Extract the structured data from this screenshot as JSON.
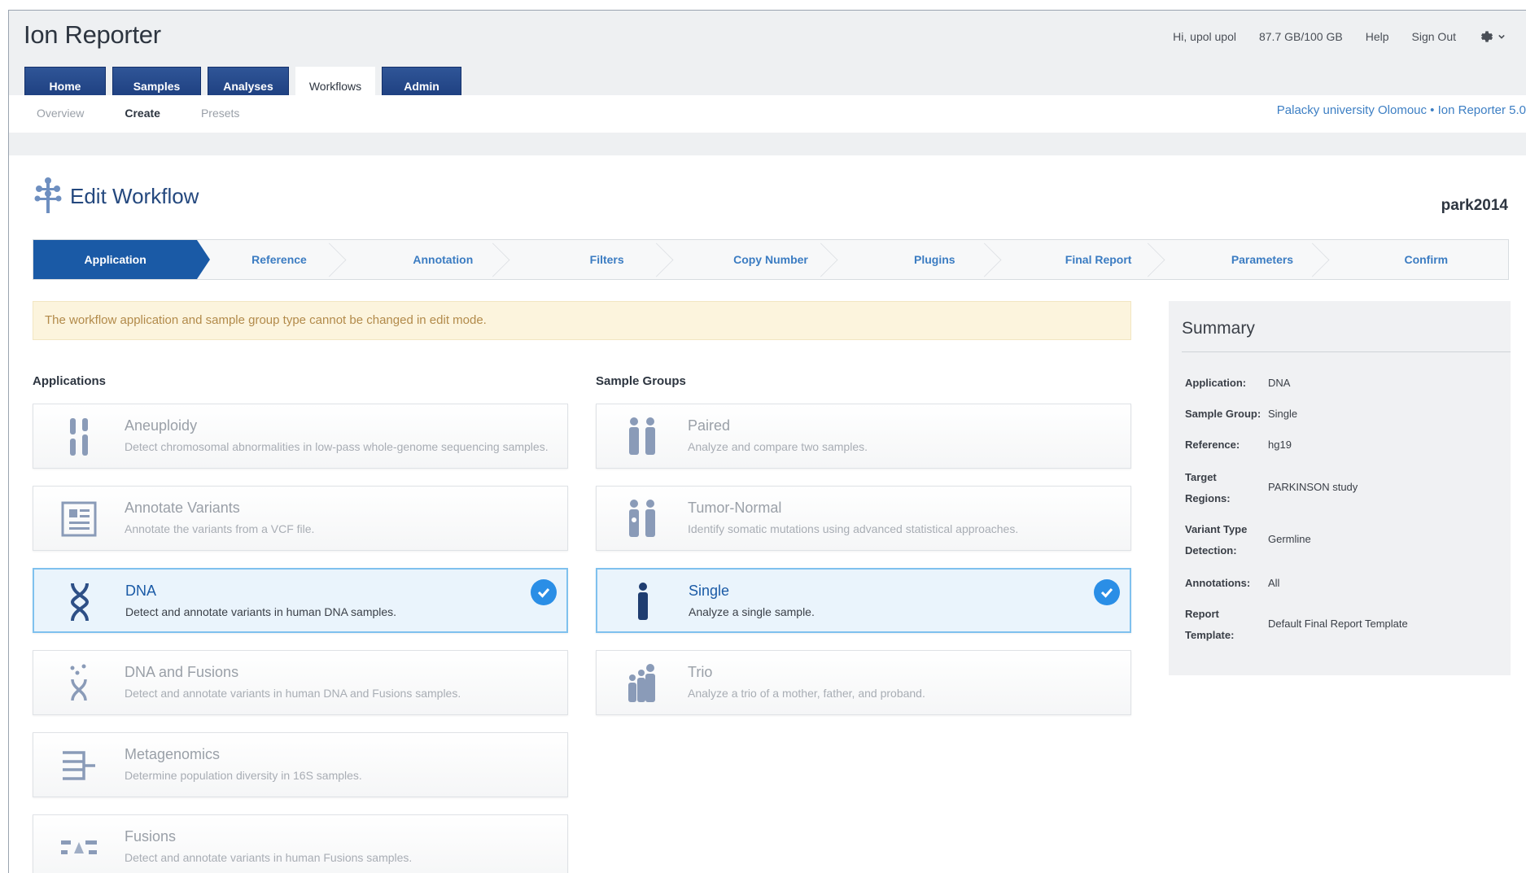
{
  "header": {
    "app_title": "Ion Reporter",
    "user": "Hi, upol upol",
    "storage": "87.7 GB/100 GB",
    "help": "Help",
    "sign_out": "Sign Out"
  },
  "tabs": [
    {
      "label": "Home"
    },
    {
      "label": "Samples"
    },
    {
      "label": "Analyses"
    },
    {
      "label": "Workflows"
    },
    {
      "label": "Admin"
    }
  ],
  "subnav": {
    "items": [
      "Overview",
      "Create",
      "Presets"
    ],
    "breadcrumb": "Palacky university Olomouc  •  Ion Reporter 5.0"
  },
  "page": {
    "title": "Edit Workflow",
    "workflow_name": "park2014",
    "notice": "The workflow application and sample group type cannot be changed in edit mode."
  },
  "steps": [
    "Application",
    "Reference",
    "Annotation",
    "Filters",
    "Copy Number",
    "Plugins",
    "Final Report",
    "Parameters",
    "Confirm"
  ],
  "applications": {
    "title": "Applications",
    "items": [
      {
        "title": "Aneuploidy",
        "desc": "Detect chromosomal abnormalities in low-pass whole-genome sequencing samples."
      },
      {
        "title": "Annotate Variants",
        "desc": "Annotate the variants from a VCF file."
      },
      {
        "title": "DNA",
        "desc": "Detect and annotate variants in human DNA samples."
      },
      {
        "title": "DNA and Fusions",
        "desc": "Detect and annotate variants in human DNA and Fusions samples."
      },
      {
        "title": "Metagenomics",
        "desc": "Determine population diversity in 16S samples."
      },
      {
        "title": "Fusions",
        "desc": "Detect and annotate variants in human Fusions samples."
      }
    ]
  },
  "sample_groups": {
    "title": "Sample Groups",
    "items": [
      {
        "title": "Paired",
        "desc": "Analyze and compare two samples."
      },
      {
        "title": "Tumor-Normal",
        "desc": "Identify somatic mutations using advanced statistical approaches."
      },
      {
        "title": "Single",
        "desc": "Analyze a single sample."
      },
      {
        "title": "Trio",
        "desc": "Analyze a trio of a mother, father, and proband."
      }
    ]
  },
  "summary": {
    "title": "Summary",
    "rows": [
      {
        "label": "Application:",
        "value": "DNA"
      },
      {
        "label": "Sample Group:",
        "value": "Single"
      },
      {
        "label": "Reference:",
        "value": "hg19"
      },
      {
        "label": "Target Regions:",
        "value": "PARKINSON study"
      },
      {
        "label": "Variant Type Detection:",
        "value": "Germline"
      },
      {
        "label": "Annotations:",
        "value": "All"
      },
      {
        "label": "Report Template:",
        "value": "Default Final Report Template"
      }
    ]
  },
  "colors": {
    "accent": "#1a5aa6",
    "tab_dark": "#1a3a7a",
    "link": "#3d7fc4",
    "check": "#2a8ee6"
  }
}
